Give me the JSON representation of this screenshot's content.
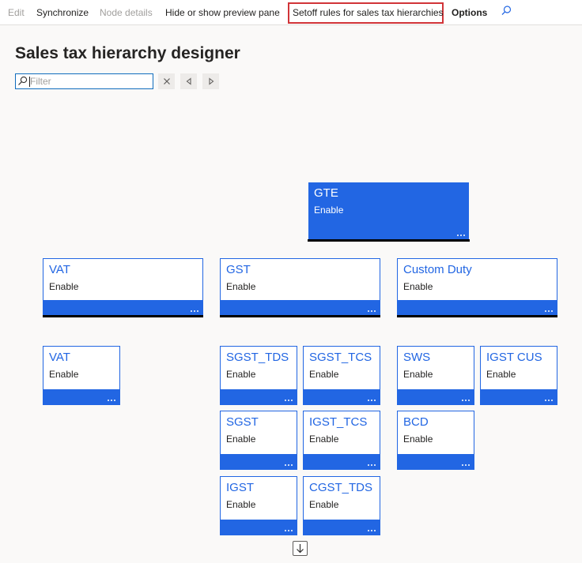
{
  "toolbar": {
    "edit": "Edit",
    "synchronize": "Synchronize",
    "node_details": "Node details",
    "hide_show_preview": "Hide or show preview pane",
    "setoff_rules": "Setoff rules for sales tax hierarchies",
    "options": "Options"
  },
  "page": {
    "title": "Sales tax hierarchy designer",
    "filter_placeholder": "Filter"
  },
  "nodes": {
    "gte": {
      "name": "GTE",
      "status": "Enable"
    },
    "vat_l1": {
      "name": "VAT",
      "status": "Enable"
    },
    "gst": {
      "name": "GST",
      "status": "Enable"
    },
    "custom_duty": {
      "name": "Custom Duty",
      "status": "Enable"
    },
    "vat_l2": {
      "name": "VAT",
      "status": "Enable"
    },
    "sgst_tds": {
      "name": "SGST_TDS",
      "status": "Enable"
    },
    "sgst_tcs": {
      "name": "SGST_TCS",
      "status": "Enable"
    },
    "sws": {
      "name": "SWS",
      "status": "Enable"
    },
    "igst_cus": {
      "name": "IGST CUS",
      "status": "Enable"
    },
    "sgst": {
      "name": "SGST",
      "status": "Enable"
    },
    "igst_tcs": {
      "name": "IGST_TCS",
      "status": "Enable"
    },
    "bcd": {
      "name": "BCD",
      "status": "Enable"
    },
    "igst": {
      "name": "IGST",
      "status": "Enable"
    },
    "cgst_tds": {
      "name": "CGST_TDS",
      "status": "Enable"
    }
  },
  "colors": {
    "accent": "#2266e3",
    "highlight": "#d13438",
    "background": "#faf9f8"
  },
  "icons": {
    "search": "search-icon",
    "clear": "close-icon",
    "previous": "previous-icon",
    "next": "next-icon",
    "more": "more-icon",
    "scroll_down": "arrow-down-icon"
  }
}
